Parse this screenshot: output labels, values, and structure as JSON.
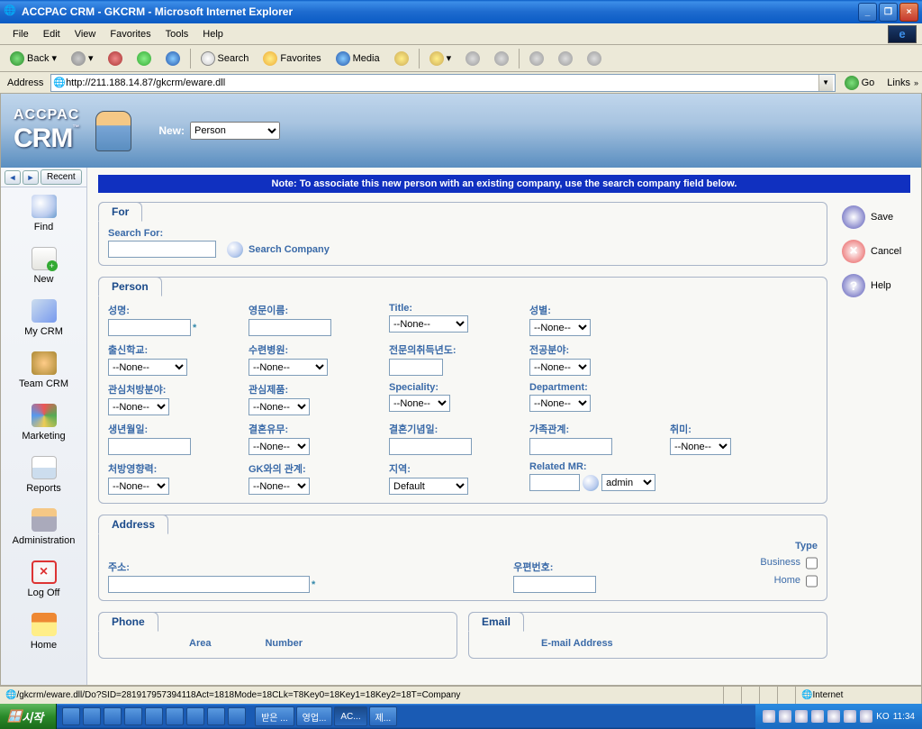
{
  "window": {
    "title": "ACCPAC CRM - GKCRM  - Microsoft Internet Explorer"
  },
  "menubar": {
    "file": "File",
    "edit": "Edit",
    "view": "View",
    "favorites": "Favorites",
    "tools": "Tools",
    "help": "Help"
  },
  "toolbar": {
    "back": "Back",
    "search": "Search",
    "favorites": "Favorites",
    "media": "Media"
  },
  "addrbar": {
    "label": "Address",
    "url": "http://211.188.14.87/gkcrm/eware.dll",
    "go": "Go",
    "links": "Links"
  },
  "crm": {
    "logo_top": "ACCPAC",
    "logo_bot": "CRM",
    "new_label": "New:",
    "new_value": "Person"
  },
  "sidebar_nav": {
    "recent": "Recent"
  },
  "sidebar": {
    "find": "Find",
    "new": "New",
    "mycrm": "My CRM",
    "teamcrm": "Team CRM",
    "marketing": "Marketing",
    "reports": "Reports",
    "admin": "Administration",
    "logoff": "Log Off",
    "home": "Home"
  },
  "note": "Note: To associate this new person with an existing company, use the search company field below.",
  "actions": {
    "save": "Save",
    "cancel": "Cancel",
    "help": "Help"
  },
  "panels": {
    "for": {
      "title": "For",
      "search_for": "Search For:",
      "search_company": "Search Company"
    },
    "person": {
      "title": "Person",
      "labels": {
        "name": "성명:",
        "engname": "영문이름:",
        "titlef": "Title:",
        "gender": "성별:",
        "school": "출신학교:",
        "hospital": "수련병원:",
        "cert_year": "전문의취득년도:",
        "major": "전공분야:",
        "interest_rx": "관심처방분야:",
        "interest_prod": "관심제품:",
        "speciality": "Speciality:",
        "department": "Department:",
        "birth": "생년월일:",
        "married": "결혼유무:",
        "anniv": "결혼기념일:",
        "family": "가족관계:",
        "hobby": "취미:",
        "rx_infl": "처방영향력:",
        "gk_rel": "GK와의 관계:",
        "region": "지역:",
        "rel_mr": "Related MR:"
      },
      "none": "--None--",
      "region_val": "Default",
      "mr_val": "admin"
    },
    "address": {
      "title": "Address",
      "addr": "주소:",
      "zip": "우편번호:",
      "type": "Type",
      "business": "Business",
      "home": "Home"
    },
    "phone": {
      "title": "Phone",
      "area": "Area",
      "number": "Number"
    },
    "email": {
      "title": "Email",
      "addr": "E-mail Address"
    }
  },
  "status": {
    "url": "/gkcrm/eware.dll/Do?SID=281917957394118Act=1818Mode=18CLk=T8Key0=18Key1=18Key2=18T=Company",
    "zone": "Internet"
  },
  "taskbar": {
    "start": "시작",
    "tasks": [
      "받은 ...",
      "영업...",
      "AC...",
      "제..."
    ],
    "lang": "KO",
    "time": "11:34"
  }
}
